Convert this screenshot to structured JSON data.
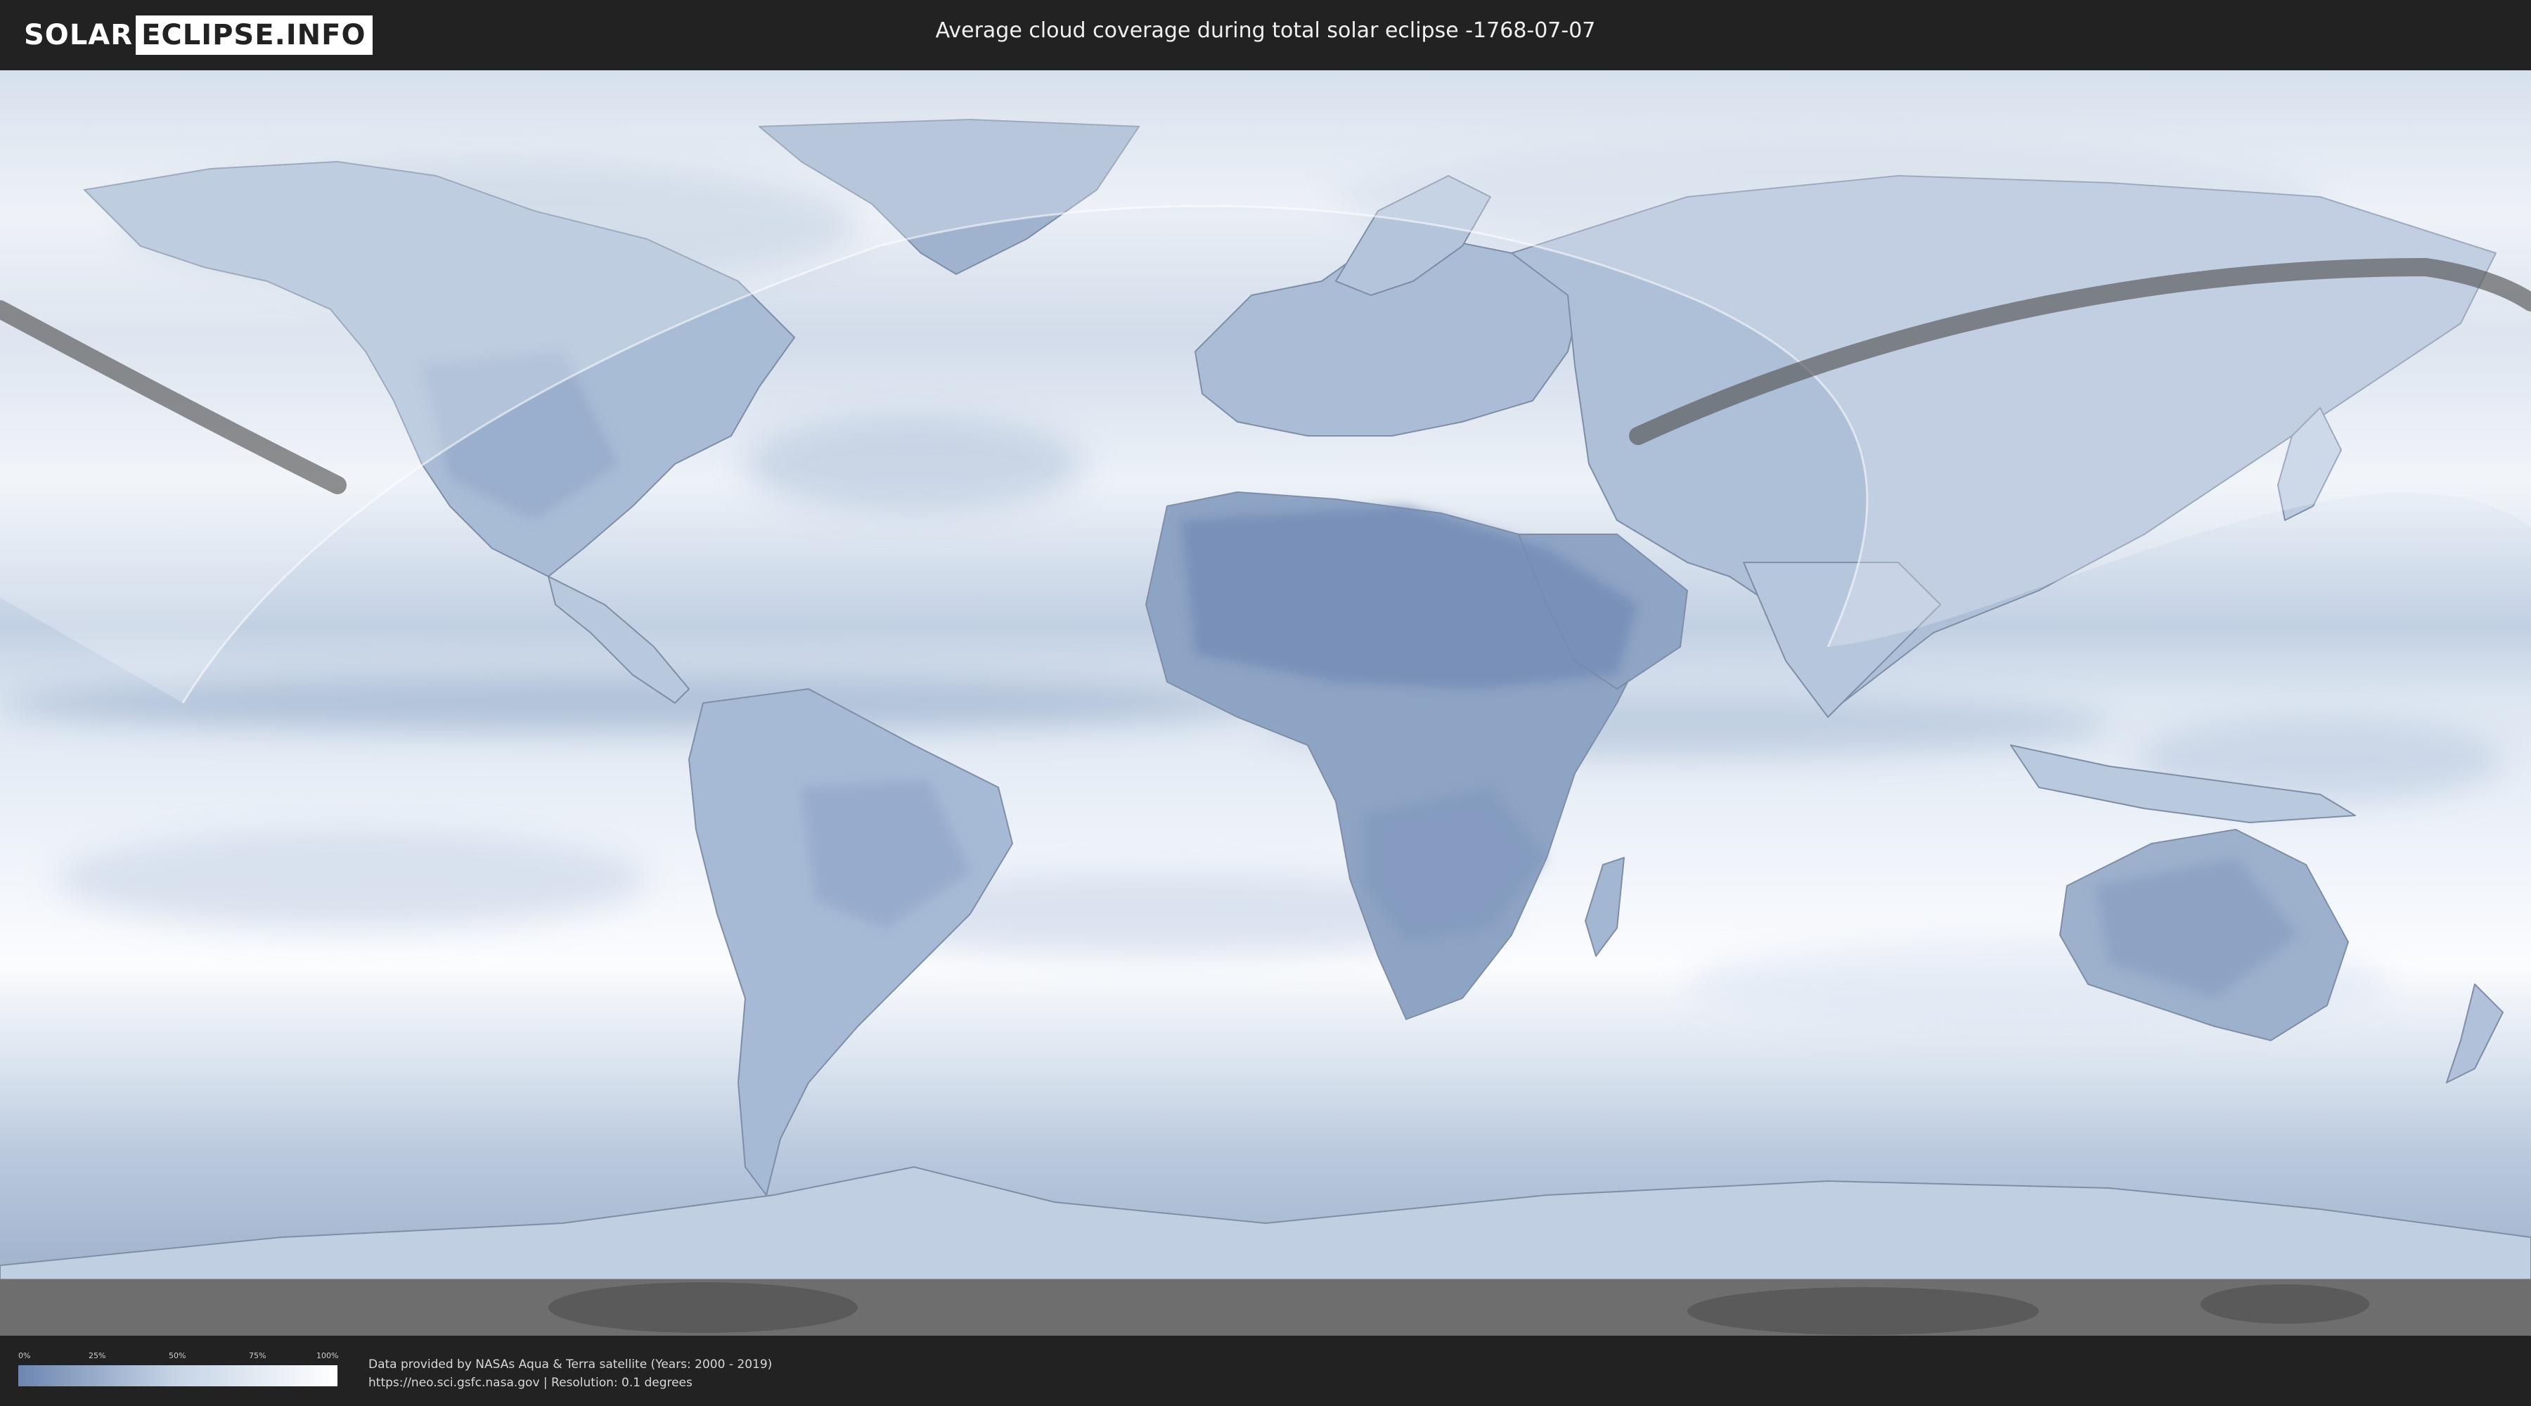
{
  "header": {
    "logo_part1": "SOLAR",
    "logo_part2": "ECLIPSE.INFO",
    "title": "Average cloud coverage during total solar eclipse -1768-07-07"
  },
  "map": {
    "projection": "equirectangular",
    "layers": [
      "cloud-coverage",
      "coastlines",
      "country-borders",
      "eclipse-visibility-zone",
      "totality-path"
    ],
    "colors": {
      "clear_sky": "#6d86b0",
      "overcast": "#ffffff",
      "totality_path": "#555555",
      "no_data": "#6e6e6e"
    }
  },
  "legend": {
    "ticks": [
      "0%",
      "25%",
      "50%",
      "75%",
      "100%"
    ]
  },
  "credits": {
    "line1": "Data provided by NASAs Aqua & Terra satellite (Years: 2000 - 2019)",
    "line2": "https://neo.sci.gsfc.nasa.gov | Resolution: 0.1 degrees"
  }
}
